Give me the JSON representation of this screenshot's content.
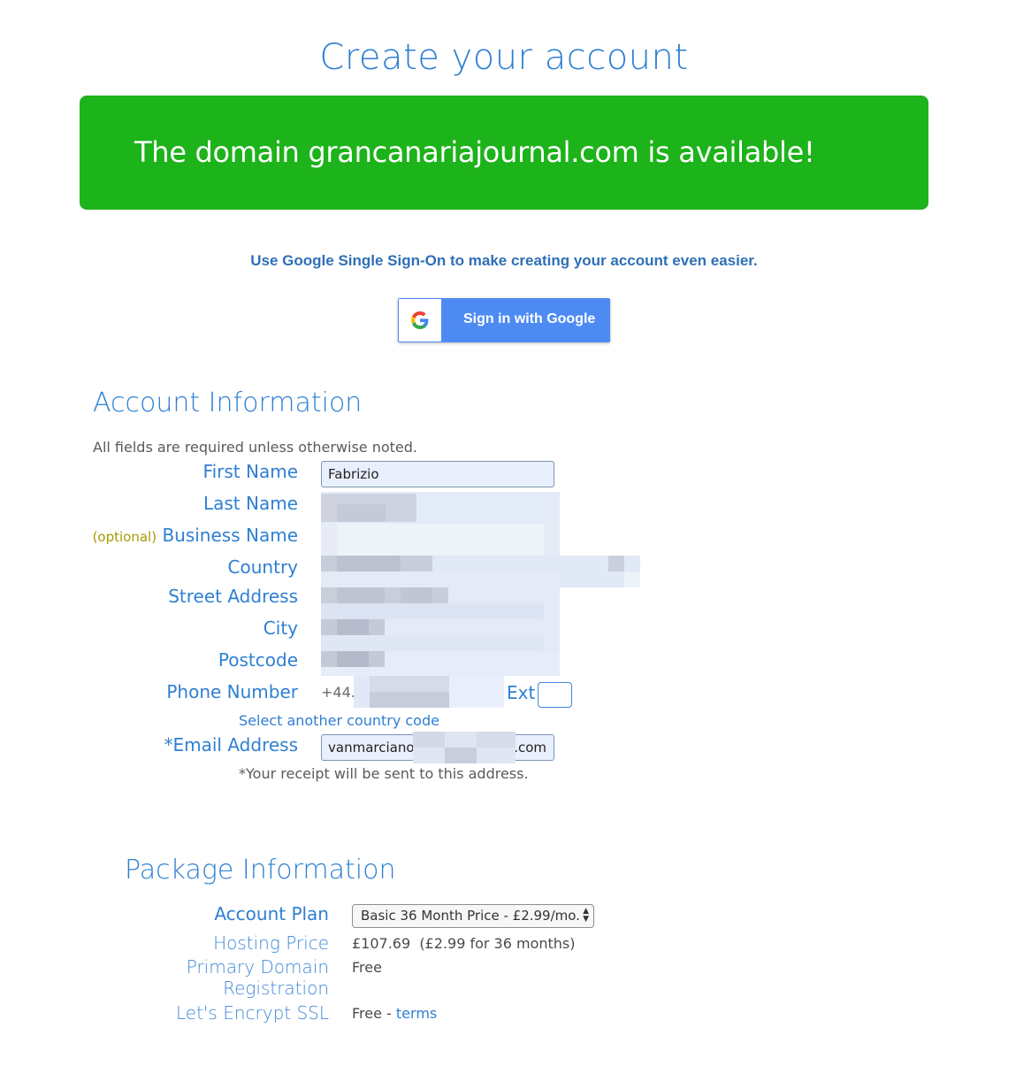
{
  "header": {
    "title": "Create your account",
    "banner_text": "The domain grancanariajournal.com is available!"
  },
  "sso": {
    "prompt": "Use Google Single Sign-On to make creating your account even easier.",
    "button_label": "Sign in with Google",
    "icon": "google-g-icon"
  },
  "account": {
    "section_title": "Account Information",
    "required_note": "All fields are required unless otherwise noted.",
    "labels": {
      "first_name": "First Name",
      "last_name": "Last Name",
      "optional": "(optional)",
      "business_name": "Business Name",
      "country": "Country",
      "street_address": "Street Address",
      "city": "City",
      "postcode": "Postcode",
      "phone": "Phone Number",
      "ext": "Ext",
      "email": "*Email Address"
    },
    "values": {
      "first_name": "Fabrizio",
      "phone_prefix": "+44.",
      "email_start": "vanmarciano",
      "email_end": ".com"
    },
    "select_country_code": "Select another country code",
    "receipt_note": "*Your receipt will be sent to this address."
  },
  "package": {
    "section_title": "Package Information",
    "account_plan_label": "Account Plan",
    "account_plan_value": "Basic 36 Month Price - £2.99/mo.",
    "hosting_price_label": "Hosting Price",
    "hosting_price_value": "£107.69  (£2.99 for 36 months)",
    "domain_label_1": "Primary Domain",
    "domain_label_2": "Registration",
    "domain_value": "Free",
    "ssl_label": "Let's Encrypt SSL",
    "ssl_value": "Free",
    "ssl_sep": " - ",
    "ssl_terms": "terms"
  },
  "colors": {
    "accent": "#2f7fd2",
    "banner_green": "#1db31a",
    "google_blue": "#4d8bf3",
    "optional_olive": "#a79a00"
  }
}
